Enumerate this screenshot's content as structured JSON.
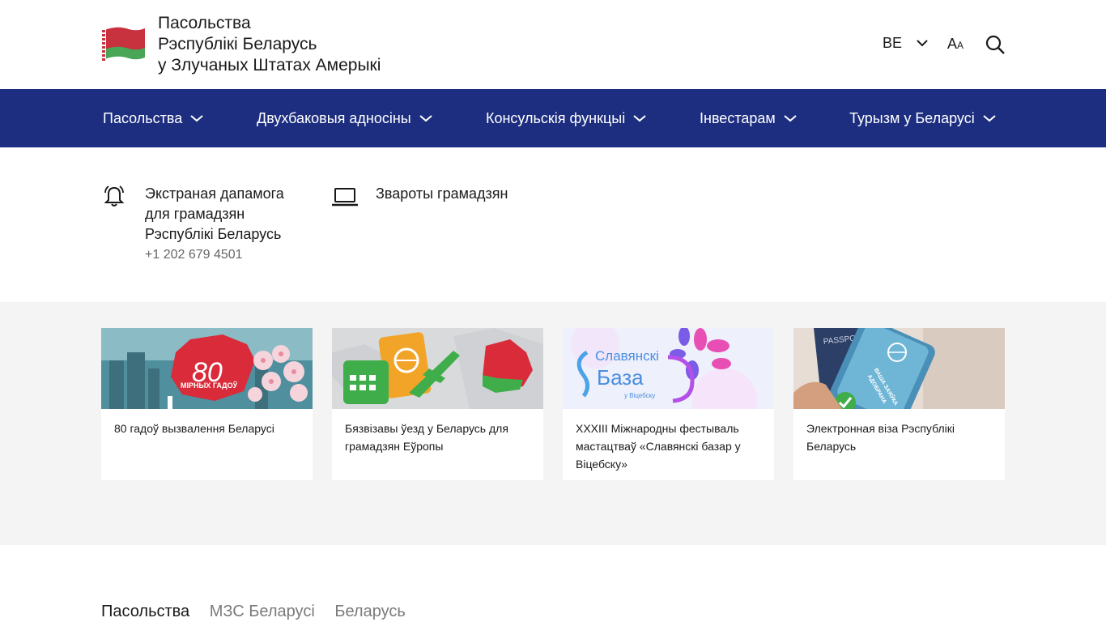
{
  "header": {
    "title_lines": [
      "Пасольства",
      "Рэспублікі Беларусь",
      "у Злучаных Штатах Амерыкі"
    ],
    "language": "BE",
    "font_size_big": "A",
    "font_size_small": "A"
  },
  "nav": {
    "items": [
      {
        "label": "Пасольства"
      },
      {
        "label": "Двухбаковыя адносіны"
      },
      {
        "label": "Консульскія функцыі"
      },
      {
        "label": "Інвестарам"
      },
      {
        "label": "Турызм у Беларусі"
      }
    ]
  },
  "quick_links": {
    "emergency": {
      "label": "Экстраная дапамога для грамадзян Рэспублікі Беларусь",
      "phone": "+1 202 679 4501"
    },
    "appeals": {
      "label": "Звароты грамадзян"
    }
  },
  "cards": [
    {
      "title": "80 гадоў вызвалення Беларусі",
      "image_text": "80",
      "image_caption": "МІРНЫХ ГАДОЎ"
    },
    {
      "title": "Бязвізавы ўезд у Беларусь для грамадзян Еўропы"
    },
    {
      "title": "XXXIII Міжнародны фестываль мастацтваў «Славянскі базар у Віцебску»",
      "image_text_1": "Славянскі",
      "image_text_2": "База",
      "image_text_3": "у Віцебску"
    },
    {
      "title": "Электронная віза Рэспублікі Беларусь",
      "image_text_1": "PASSPORT",
      "image_text_2": "ВАША ЗАЯЎКА",
      "image_text_3": "АДОБРАНА"
    }
  ],
  "footer_tabs": [
    {
      "label": "Пасольства",
      "active": true
    },
    {
      "label": "МЗС Беларусі",
      "active": false
    },
    {
      "label": "Беларусь",
      "active": false
    }
  ],
  "colors": {
    "nav_bg": "#1d2e80",
    "section_bg": "#f4f4f4",
    "flag_red": "#c8313e",
    "flag_green": "#4aa657"
  }
}
